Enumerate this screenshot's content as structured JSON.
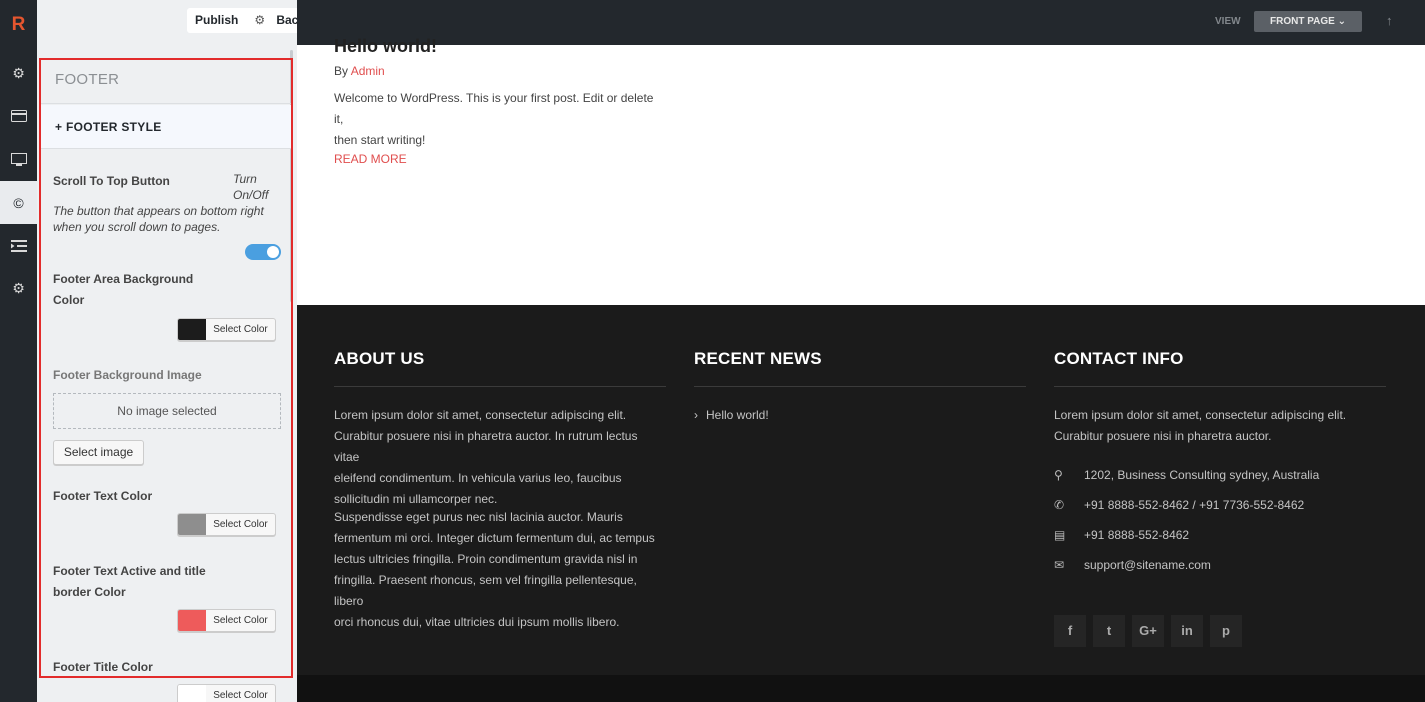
{
  "rail": {
    "logo": "R",
    "icons": [
      "gear-icon",
      "card-icon",
      "monitor-icon",
      "copyright-icon",
      "list-indent-icon",
      "gear-icon"
    ]
  },
  "panel": {
    "publish_label": "Publish",
    "back_label": "Back",
    "section_title": "FOOTER",
    "subsection_title": "+ FOOTER STYLE",
    "scroll_to_top": {
      "label": "Scroll To Top Button",
      "hint_line1": "Turn",
      "hint_line2": "On/Off",
      "description_line1": "The button that appears on bottom right",
      "description_line2": "when you scroll down to pages.",
      "enabled": true
    },
    "footer_area_bg": {
      "label_line1": "Footer Area Background",
      "label_line2": "Color",
      "button": "Select Color",
      "color": "#1c1c1c"
    },
    "footer_bg_image": {
      "label": "Footer Background Image",
      "placeholder": "No image selected",
      "button": "Select image"
    },
    "footer_text_color": {
      "label": "Footer Text Color",
      "button": "Select Color",
      "color": "#8e8e8e"
    },
    "footer_text_active": {
      "label_line1": "Footer Text Active and title",
      "label_line2": "border Color",
      "button": "Select Color",
      "color": "#ee5b5b"
    },
    "footer_title_color": {
      "label": "Footer Title Color",
      "button": "Select Color",
      "color": "#ffffff"
    }
  },
  "preview_bar": {
    "view_label": "VIEW",
    "front_page_label": "FRONT PAGE"
  },
  "post": {
    "title": "Hello world!",
    "by": "By",
    "author": "Admin",
    "excerpt_line1": "Welcome to WordPress. This is your first post. Edit or delete it,",
    "excerpt_line2": "then start writing!",
    "read_more": "READ MORE"
  },
  "footer": {
    "about": {
      "title": "ABOUT US",
      "p1": [
        "Lorem ipsum dolor sit amet, consectetur adipiscing elit.",
        "Curabitur posuere nisi in pharetra auctor. In rutrum lectus vitae",
        "eleifend condimentum. In vehicula varius leo, faucibus",
        "sollicitudin mi ullamcorper nec."
      ],
      "p2": [
        "Suspendisse eget purus nec nisl lacinia auctor. Mauris",
        "fermentum mi orci. Integer dictum fermentum dui, ac tempus",
        "lectus ultricies fringilla. Proin condimentum gravida nisl in",
        "fringilla. Praesent rhoncus, sem vel fringilla pellentesque, libero",
        "orci rhoncus dui, vitae ultricies dui ipsum mollis libero."
      ]
    },
    "news": {
      "title": "RECENT NEWS",
      "item": "Hello world!"
    },
    "contact": {
      "title": "CONTACT INFO",
      "intro_line1": "Lorem ipsum dolor sit amet, consectetur adipiscing elit.",
      "intro_line2": "Curabitur posuere nisi in pharetra auctor.",
      "address": "1202, Business Consulting sydney, Australia",
      "phone": "+91 8888-552-8462 / +91 7736-552-8462",
      "fax": "+91 8888-552-8462",
      "email": "support@sitename.com"
    },
    "social": [
      "f",
      "t",
      "G+",
      "in",
      "p"
    ]
  }
}
